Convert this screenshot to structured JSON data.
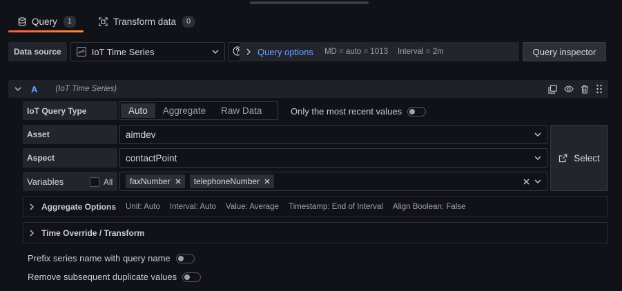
{
  "tabs": [
    {
      "label": "Query",
      "count": "1"
    },
    {
      "label": "Transform data",
      "count": "0"
    }
  ],
  "datasource": {
    "label": "Data source",
    "selected": "IoT Time Series"
  },
  "query_options": {
    "title": "Query options",
    "md": "MD = auto = 1013",
    "interval": "Interval = 2m"
  },
  "query_inspector_label": "Query inspector",
  "query": {
    "ref_id": "A",
    "datasource_name": "(IoT Time Series)",
    "type_label": "IoT Query Type",
    "type_options": [
      "Auto",
      "Aggregate",
      "Raw Data"
    ],
    "type_selected": "Auto",
    "most_recent_label": "Only the most recent values",
    "asset_label": "Asset",
    "asset_value": "aimdev",
    "aspect_label": "Aspect",
    "aspect_value": "contactPoint",
    "variables_label": "Variables",
    "all_label": "All",
    "variables": [
      "faxNumber",
      "telephoneNumber"
    ],
    "select_button": "Select",
    "aggregate": {
      "title": "Aggregate Options",
      "meta": [
        "Unit: Auto",
        "Interval: Auto",
        "Value: Average",
        "Timestamp: End of Interval",
        "Align Boolean: False"
      ]
    },
    "time_override_title": "Time Override / Transform",
    "prefix_label": "Prefix series name with query name",
    "dedupe_label": "Remove subsequent duplicate values"
  },
  "colors": {
    "background": "#111217",
    "accent_blue": "#6e9fff",
    "tab_underline": "#ff7a38"
  }
}
